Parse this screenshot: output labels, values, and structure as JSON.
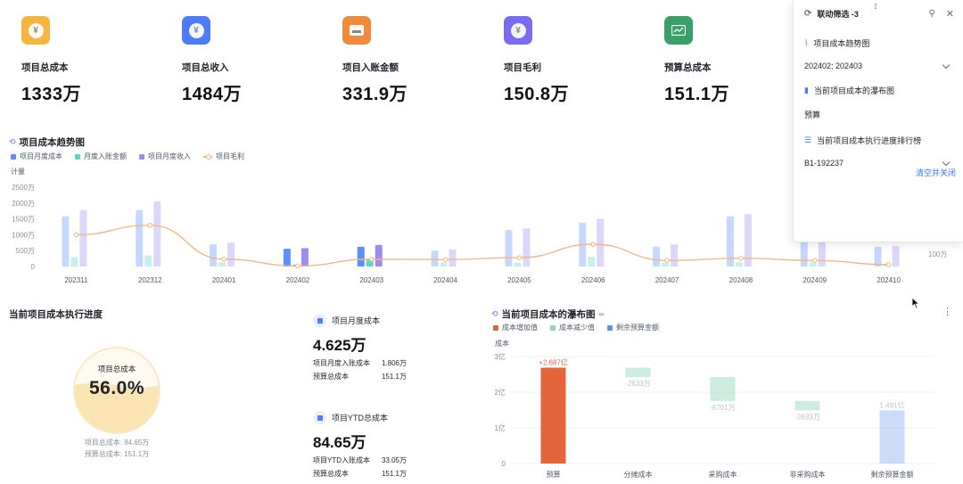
{
  "kpis": [
    {
      "label": "项目总成本",
      "value": "1333万",
      "color": "#f4b63f",
      "icon": "yuan-icon"
    },
    {
      "label": "项目总收入",
      "value": "1484万",
      "color": "#4e7cf6",
      "icon": "yuan-icon"
    },
    {
      "label": "项目入账金额",
      "value": "331.9万",
      "color": "#f08a3c",
      "icon": "wallet-icon"
    },
    {
      "label": "项目毛利",
      "value": "150.8万",
      "color": "#7a6cf2",
      "icon": "yuan-shield-icon"
    },
    {
      "label": "预算总成本",
      "value": "151.1万",
      "color": "#3aa06a",
      "icon": "trend-chart-icon"
    }
  ],
  "trend": {
    "title": "项目成本趋势图",
    "legend": [
      "项目月度成本",
      "月度入账金额",
      "项目月度收入",
      "项目毛利"
    ],
    "ylabel": "计量",
    "yticks": [
      "2500万",
      "2000万",
      "1500万",
      "1000万",
      "500万",
      "0"
    ],
    "right_tick": "100万"
  },
  "chart_data": [
    {
      "type": "bar",
      "title": "项目成本趋势图",
      "ylabel": "计量",
      "ylim": [
        0,
        2500
      ],
      "categories": [
        "202311",
        "202312",
        "202401",
        "202402",
        "202403",
        "202404",
        "202405",
        "202406",
        "202407",
        "202408",
        "202409",
        "202410"
      ],
      "series": [
        {
          "name": "项目月度成本",
          "values": [
            1580,
            1780,
            700,
            560,
            620,
            500,
            1150,
            1380,
            630,
            1580,
            1650,
            620
          ],
          "color": "#5b8ff9"
        },
        {
          "name": "月度入账金额",
          "values": [
            300,
            350,
            130,
            60,
            240,
            130,
            120,
            310,
            120,
            130,
            130,
            90
          ],
          "color": "#5ad8c6"
        },
        {
          "name": "项目月度收入",
          "values": [
            1780,
            2050,
            750,
            580,
            680,
            540,
            1200,
            1500,
            700,
            1650,
            1700,
            650
          ],
          "color": "#9c8cf0"
        },
        {
          "name": "项目毛利",
          "values": [
            1000,
            1300,
            230,
            20,
            230,
            220,
            280,
            700,
            190,
            260,
            190,
            60
          ],
          "color": "#f0b37e",
          "kind": "line"
        }
      ],
      "highlight": [
        "202402",
        "202403"
      ]
    },
    {
      "type": "bar",
      "title": "当前项目成本的瀑布图",
      "ylabel": "成本",
      "ylim": [
        0,
        3
      ],
      "yticks": [
        "3亿",
        "2亿",
        "1亿",
        "0"
      ],
      "legend": [
        "成本增加值",
        "成本减少值",
        "剩余预算金额"
      ],
      "categories": [
        "预算",
        "分摊成本",
        "采购成本",
        "非采购成本",
        "剩余预算金额"
      ],
      "series": [
        {
          "name": "成本增加值",
          "values": [
            2.687,
            null,
            null,
            null,
            null
          ],
          "color": "#e4643c"
        },
        {
          "name": "成本减少值",
          "values": [
            null,
            -0.2633,
            -0.6701,
            -0.2633,
            null
          ],
          "color": "#8fd5b8"
        },
        {
          "name": "剩余预算金额",
          "values": [
            null,
            null,
            null,
            null,
            1.491
          ],
          "color": "#8fb0f0"
        }
      ],
      "labels": [
        "+2.687亿",
        "-2633万",
        "-6701万",
        "-2633万",
        "1.491亿"
      ]
    }
  ],
  "progress": {
    "title": "当前项目成本执行进度",
    "gauge_label": "项目总成本",
    "gauge_value": "56.0%",
    "gauge_fraction": 0.56,
    "note1": "项目总成本: 84.65万",
    "note2": "预算总成本: 151.1万"
  },
  "monthly": {
    "title": "项目月度成本",
    "value": "4.625万",
    "row1_label": "项目月度入账成本",
    "row1_value": "1.806万",
    "row2_label": "预算总成本",
    "row2_value": "151.1万"
  },
  "ytd": {
    "title": "项目YTD总成本",
    "value": "84.65万",
    "row1_label": "项目YTD入账成本",
    "row1_value": "33.05万",
    "row2_label": "预算总成本",
    "row2_value": "151.1万"
  },
  "waterfall": {
    "title": "当前项目成本的瀑布图",
    "legend": [
      "成本增加值",
      "成本减少值",
      "剩余预算金额"
    ],
    "ylabel": "成本"
  },
  "panel": {
    "title": "联动筛选 -3",
    "groups": [
      {
        "label": "项目成本趋势图",
        "value": "202402; 202403"
      },
      {
        "label": "当前项目成本的瀑布图",
        "value": "预算"
      },
      {
        "label": "当前项目成本执行进度排行榜",
        "value": "B1-192237"
      }
    ],
    "clear": "清空并关闭"
  }
}
